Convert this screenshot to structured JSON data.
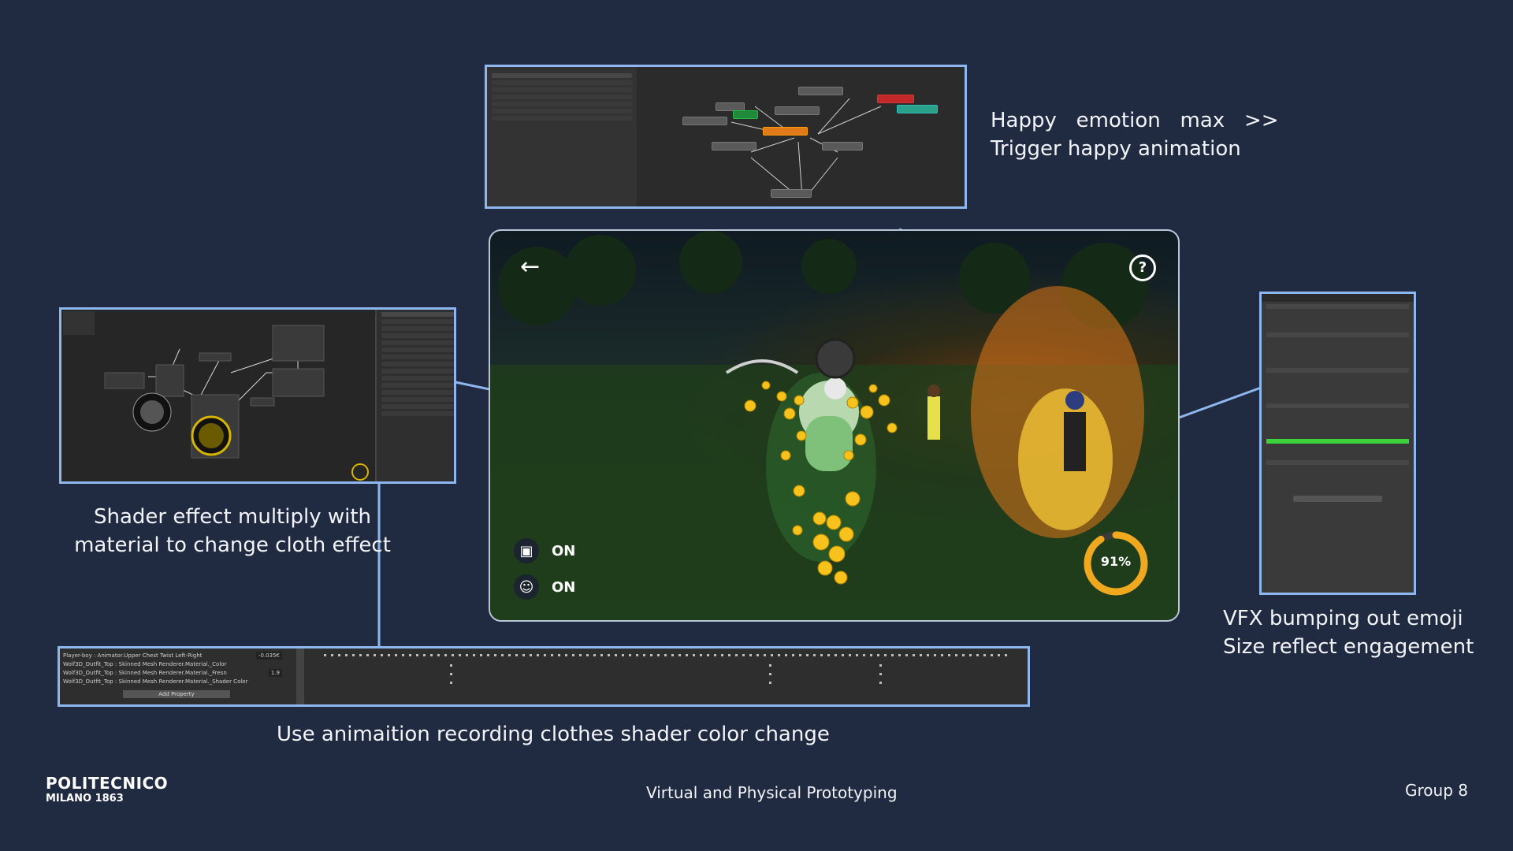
{
  "captions": {
    "happy_line1": "Happy   emotion   max   >>",
    "happy_line2": "Trigger happy animation",
    "shader_line1": "Shader effect multiply with",
    "shader_line2": "material to change cloth effect",
    "vfx_line1": "VFX bumping out emoji",
    "vfx_line2": "Size reflect engagement",
    "anim_line": "Use animaition recording clothes shader color change"
  },
  "game": {
    "camera_status": "ON",
    "emotion_status": "ON",
    "engagement_progress": 0.91,
    "engagement_label": "91%"
  },
  "timeline": {
    "rows": [
      "Player-boy : Animator.Upper Chest Twist Left-Right",
      "Wolf3D_Outfit_Top : Skinned Mesh Renderer.Material._Color",
      "Wolf3D_Outfit_Top : Skinned Mesh Renderer.Material._Fresn",
      "Wolf3D_Outfit_Top : Skinned Mesh Renderer.Material._Shader Color"
    ],
    "row_values": [
      "-0.035€",
      "",
      "1.9",
      ""
    ],
    "add_property": "Add Property"
  },
  "footer": {
    "logo_line1": "POLITECNICO",
    "logo_line2": "MILANO 1863",
    "course": "Virtual and Physical Prototyping",
    "group": "Group 8"
  },
  "icons": {
    "back": "arrow-left-icon",
    "help": "question-circle-icon",
    "camera": "camera-icon",
    "emotion": "smiley-icon"
  },
  "colors": {
    "background": "#202a40",
    "frame": "#8fb7ef",
    "progress": "#f0a91f"
  }
}
